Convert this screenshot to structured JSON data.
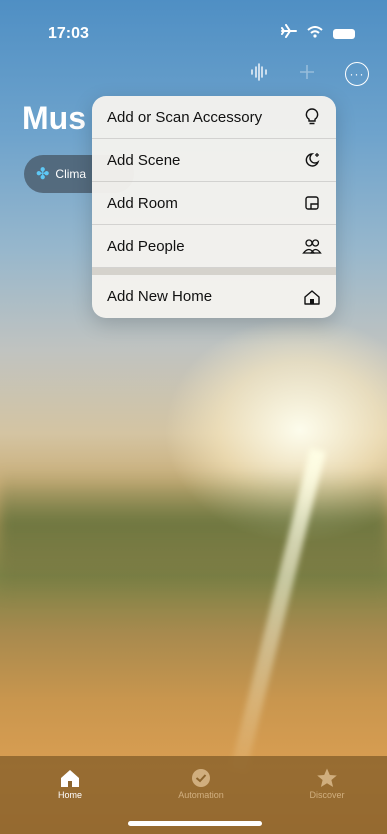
{
  "status": {
    "time": "17:03"
  },
  "home": {
    "title": "Mus",
    "chip_label": "Clima"
  },
  "menu": {
    "items": [
      {
        "label": "Add or Scan Accessory",
        "icon": "lightbulb-icon"
      },
      {
        "label": "Add Scene",
        "icon": "scene-icon"
      },
      {
        "label": "Add Room",
        "icon": "room-icon"
      },
      {
        "label": "Add People",
        "icon": "people-icon"
      }
    ],
    "secondary": {
      "label": "Add New Home",
      "icon": "home-icon"
    }
  },
  "tabbar": {
    "home": "Home",
    "automation": "Automation",
    "discover": "Discover"
  }
}
